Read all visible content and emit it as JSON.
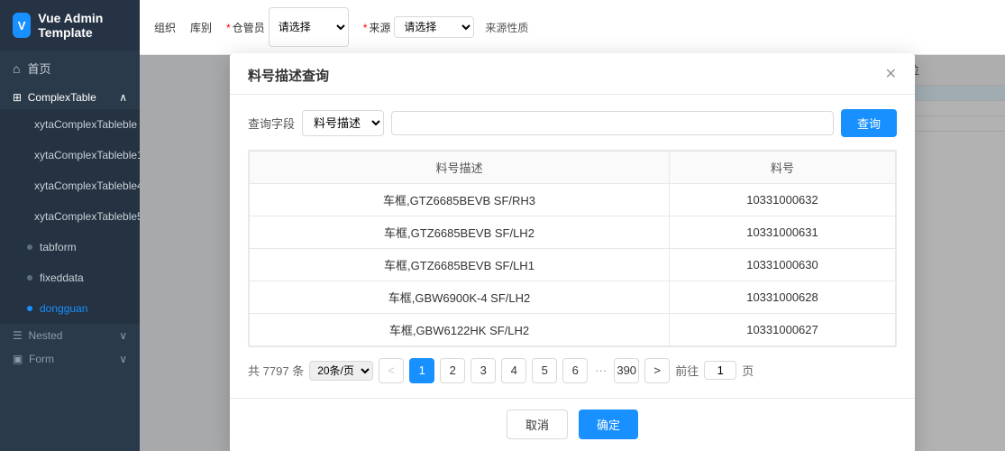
{
  "app": {
    "logo_letter": "V",
    "title": "Vue Admin Template"
  },
  "sidebar": {
    "home_label": "首页",
    "home_icon": "⌂",
    "sections": [
      {
        "key": "complex_table",
        "label": "ComplexTable",
        "expanded": true,
        "items": [
          {
            "key": "xytaComplexTableble",
            "label": "xytaComplexTableble",
            "active": false
          },
          {
            "key": "xytaComplexTableble1",
            "label": "xytaComplexTableble1",
            "active": false
          },
          {
            "key": "xytaComplexTableble4",
            "label": "xytaComplexTableble4",
            "active": false
          },
          {
            "key": "xytaComplexTableble5",
            "label": "xytaComplexTableble5",
            "active": false
          },
          {
            "key": "tabform",
            "label": "tabform",
            "active": false
          },
          {
            "key": "fixeddata",
            "label": "fixeddata",
            "active": false
          },
          {
            "key": "dongguan",
            "label": "dongguan",
            "active": true
          }
        ]
      },
      {
        "key": "nested",
        "label": "Nested",
        "expanded": false,
        "items": []
      },
      {
        "key": "form",
        "label": "Form",
        "expanded": false,
        "items": []
      }
    ]
  },
  "main_header": {
    "cols": [
      {
        "label": "组织",
        "required": false
      },
      {
        "label": "库别",
        "required": false
      },
      {
        "label": "仓管员",
        "required": true,
        "placeholder": "请选择"
      },
      {
        "label": "来源",
        "required": true,
        "placeholder": "请选择"
      }
    ]
  },
  "modal": {
    "title": "料号描述查询",
    "search_label": "查询字段",
    "search_field_value": "料号描述",
    "search_placeholder": "",
    "query_button": "查询",
    "table": {
      "col1": "料号描述",
      "col2": "料号",
      "rows": [
        {
          "desc": "车框,GTZ6685BEVB SF/RH3",
          "code": "10331000632"
        },
        {
          "desc": "车框,GTZ6685BEVB SF/LH2",
          "code": "10331000631"
        },
        {
          "desc": "车框,GTZ6685BEVB SF/LH1",
          "code": "10331000630"
        },
        {
          "desc": "车框,GBW6900K-4 SF/LH2",
          "code": "10331000628"
        },
        {
          "desc": "车框,GBW6122HK SF/LH2",
          "code": "10331000627"
        }
      ]
    },
    "pagination": {
      "total_label": "共",
      "total": "7797",
      "total_unit": "条",
      "page_size": "20",
      "page_size_unit": "条/页",
      "pages": [
        "1",
        "2",
        "3",
        "4",
        "5",
        "6"
      ],
      "ellipsis": "···",
      "last_page": "390",
      "goto_label": "前往",
      "current_page": "1",
      "page_unit": "页"
    },
    "cancel_label": "取消",
    "confirm_label": "确定"
  },
  "bg_table": {
    "col_label": "货位",
    "cells": [
      "",
      "",
      ""
    ]
  },
  "colors": {
    "primary": "#1890ff",
    "sidebar_bg": "#2b3a4a",
    "active_item": "#1890ff"
  }
}
